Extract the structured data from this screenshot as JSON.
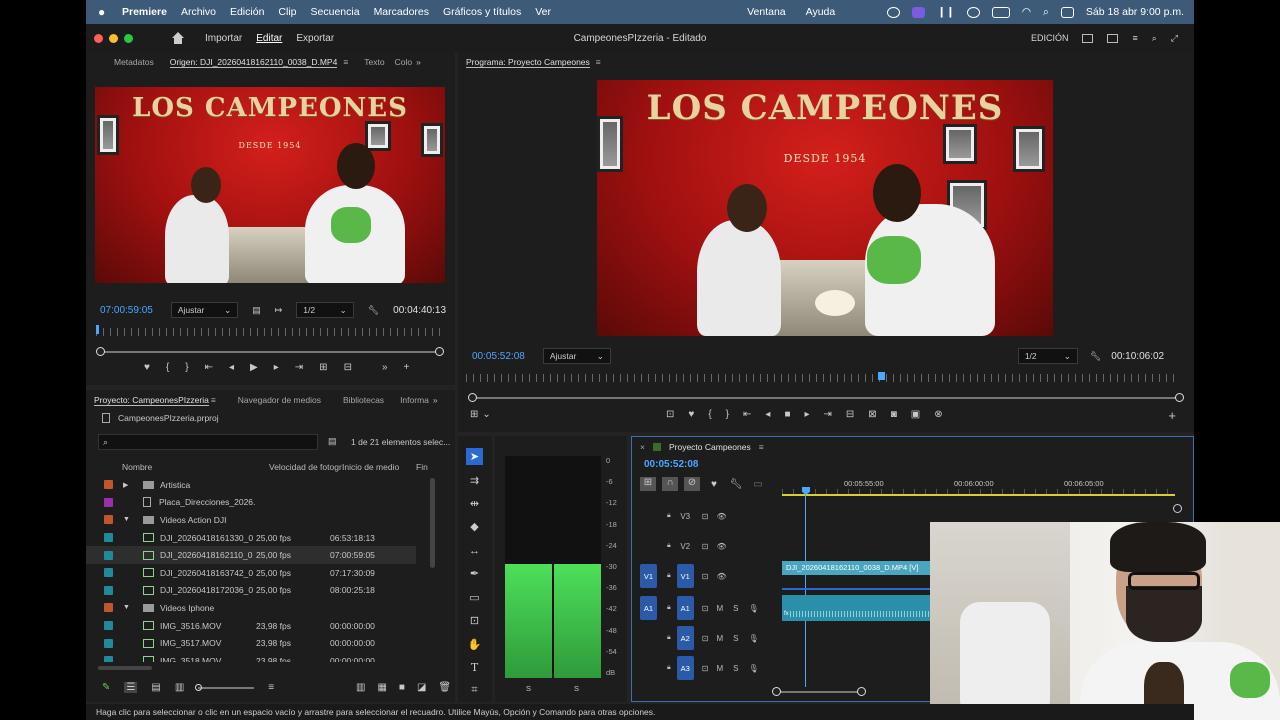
{
  "menubar": {
    "app": "Premiere",
    "items": [
      "Archivo",
      "Edición",
      "Clip",
      "Secuencia",
      "Marcadores",
      "Gráficos y títulos",
      "Ver"
    ],
    "right_items": [
      "Ventana",
      "Ayuda"
    ],
    "datetime": "Sáb 18 abr 9:00 p.m."
  },
  "titlebar": {
    "workspaces": {
      "import": "Importar",
      "edit": "Editar",
      "export": "Exportar"
    },
    "title": "CampeonesPIzzeria - Editado",
    "mode": "EDICIÓN"
  },
  "source_panel": {
    "tabs": [
      "Metadatos",
      "Origen: DJI_20260418162110_0038_D.MP4",
      "Texto",
      "Colo"
    ],
    "timecode": "07:00:59:05",
    "fit": "Ajustar",
    "resolution": "1/2",
    "duration": "00:04:40:13",
    "sign_text": "LOS CAMPEONES",
    "sign_sub": "DESDE 1954"
  },
  "program_panel": {
    "tab": "Programa: Proyecto Campeones",
    "timecode": "00:05:52:08",
    "fit": "Ajustar",
    "resolution": "1/2",
    "duration": "00:10:06:02",
    "sign_text": "LOS CAMPEONES",
    "sign_sub": "DESDE 1954"
  },
  "project_panel": {
    "tabs": [
      "Proyecto: CampeonesPIzzeria",
      "Navegador de medios",
      "Bibliotecas",
      "Informa"
    ],
    "file": "CampeonesPIzzeria.prproj",
    "count": "1 de 21 elementos selec...",
    "columns": [
      "Nombre",
      "Velocidad de fotogr",
      "Inicio de medio",
      "Fin"
    ],
    "rows": [
      {
        "name": "Artistica",
        "fps": "",
        "start": "",
        "type": "folder",
        "color": "#c0562a",
        "indent": 0,
        "toggle": "▶"
      },
      {
        "name": "Placa_Direcciones_2026.png",
        "fps": "",
        "start": "",
        "type": "file",
        "color": "#9b2fae",
        "indent": 1,
        "toggle": ""
      },
      {
        "name": "Videos Action DJI",
        "fps": "",
        "start": "",
        "type": "folder",
        "color": "#c0562a",
        "indent": 0,
        "toggle": "▼"
      },
      {
        "name": "DJI_20260418161330_0",
        "fps": "25,00 fps",
        "start": "06:53:18:13",
        "type": "clip",
        "color": "#1f8a9a",
        "indent": 1,
        "toggle": ""
      },
      {
        "name": "DJI_20260418162110_0",
        "fps": "25,00 fps",
        "start": "07:00:59:05",
        "type": "clip",
        "color": "#1f8a9a",
        "indent": 1,
        "toggle": "",
        "selected": true
      },
      {
        "name": "DJI_20260418163742_0",
        "fps": "25,00 fps",
        "start": "07:17:30:09",
        "type": "clip",
        "color": "#1f8a9a",
        "indent": 1,
        "toggle": ""
      },
      {
        "name": "DJI_20260418172036_0",
        "fps": "25,00 fps",
        "start": "08:00:25:18",
        "type": "clip",
        "color": "#1f8a9a",
        "indent": 1,
        "toggle": ""
      },
      {
        "name": "Videos Iphone",
        "fps": "",
        "start": "",
        "type": "folder",
        "color": "#c0562a",
        "indent": 0,
        "toggle": "▼"
      },
      {
        "name": "IMG_3516.MOV",
        "fps": "23,98 fps",
        "start": "00:00:00:00",
        "type": "clip",
        "color": "#1f8a9a",
        "indent": 1,
        "toggle": ""
      },
      {
        "name": "IMG_3517.MOV",
        "fps": "23,98 fps",
        "start": "00:00:00:00",
        "type": "clip",
        "color": "#1f8a9a",
        "indent": 1,
        "toggle": ""
      },
      {
        "name": "IMG_3518.MOV",
        "fps": "23,98 fps",
        "start": "00:00:00:00",
        "type": "clip",
        "color": "#1f8a9a",
        "indent": 1,
        "toggle": ""
      }
    ]
  },
  "audio_meter": {
    "scale": [
      "0",
      "-6",
      "-12",
      "-18",
      "-24",
      "-30",
      "-36",
      "-42",
      "-48",
      "-54",
      "dB"
    ],
    "solo_labels": [
      "S",
      "S"
    ],
    "level_db": -12
  },
  "timeline": {
    "tab": "Proyecto Campeones",
    "timecode": "00:05:52:08",
    "ruler": [
      "00:05:55:00",
      "00:06:00:00",
      "00:06:05:00"
    ],
    "tracks_video": [
      {
        "name": "V3",
        "source": ""
      },
      {
        "name": "V2",
        "source": ""
      },
      {
        "name": "V1",
        "source": "V1"
      }
    ],
    "tracks_audio": [
      {
        "name": "A1",
        "source": "A1"
      },
      {
        "name": "A2",
        "source": ""
      },
      {
        "name": "A3",
        "source": ""
      }
    ],
    "mute_label": "M",
    "solo_label": "S",
    "clip_label": "DJI_20260418162110_0038_D.MP4 [V]",
    "audio_clip_marker": "fx"
  },
  "status": "Haga clic para seleccionar o clic en un espacio vacío y arrastre para seleccionar el recuadro. Utilice Mayús, Opción y Comando para otras opciones."
}
